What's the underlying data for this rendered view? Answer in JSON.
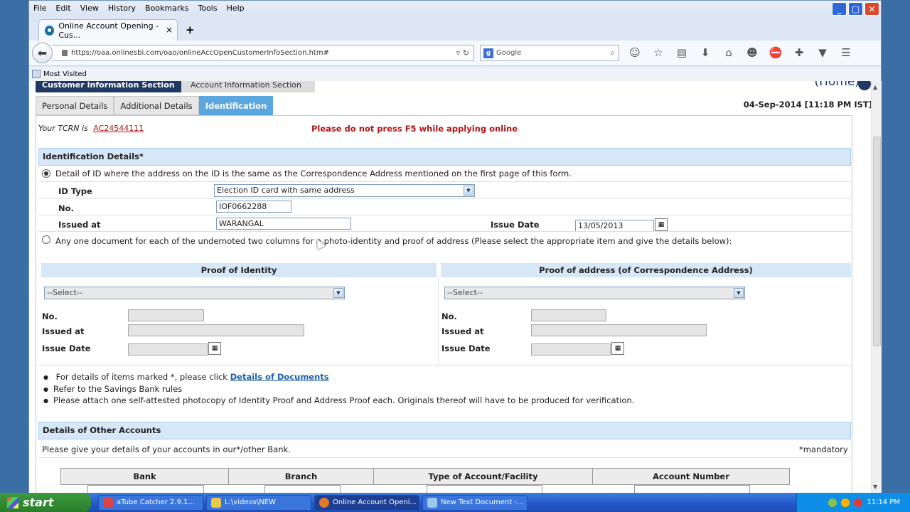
{
  "browser": {
    "menu": [
      "File",
      "Edit",
      "View",
      "History",
      "Bookmarks",
      "Tools",
      "Help"
    ],
    "tab_title": "Online Account Opening - Cus...",
    "tab_close": "×",
    "new_tab": "+",
    "url": "https://oaa.onlinesbi.com/oao/onlineAccOpenCustomerInfoSection.htm#",
    "search_engine_glyph": "g",
    "search_placeholder": "Google",
    "bookmark_most_visited": "Most Visited"
  },
  "page": {
    "section_tab_active": "Customer Information Section",
    "section_tab_inactive": "Account Information Section",
    "home_label": "(Home)",
    "subtabs": [
      "Personal Details",
      "Additional Details",
      "Identification"
    ],
    "datetime": "04-Sep-2014 [11:18 PM IST]",
    "tcrn_label": "Your TCRN is",
    "tcrn_value": "AC24544111",
    "warning": "Please do not press F5 while applying online",
    "id_details_header": "Identification Details*",
    "option1_text": "Detail of ID where the address on the ID is the same as the Correspondence Address mentioned on the first page of this form.",
    "id_type_label": "ID Type",
    "id_type_value": "Election ID card with same address",
    "no_label": "No.",
    "no_value": "IOF0662288",
    "issued_at_label": "Issued at",
    "issued_at_value": "WARANGAL",
    "issue_date_label": "Issue Date",
    "issue_date_value": "13/05/2013",
    "option2_text": "Any one document for each of the undernoted two columns for a photo-identity and proof of address (Please select the appropriate item  and give the details below):",
    "proof_identity_header": "Proof of Identity",
    "proof_address_header": "Proof of address (of Correspondence Address)",
    "select_placeholder": "--Select--",
    "left_no": "No.",
    "left_issued_at": "Issued at",
    "left_issue_date": "Issue Date",
    "right_no": "No.",
    "right_issued_at": "Issued at",
    "right_issue_date": "Issue Date",
    "note1_prefix": "For details of items marked *, please click ",
    "note1_link": "Details of Documents",
    "note2": "Refer to the Savings Bank rules",
    "note3": "Please attach one self-attested photocopy of Identity Proof and Address Proof each. Originals thereof will have to be produced for verification.",
    "other_accounts_header": "Details of Other Accounts",
    "other_accounts_text": "Please give your details of your accounts in our*/other Bank.",
    "mandatory_note": "*mandatory",
    "table_headers": [
      "Bank",
      "Branch",
      "Type of Account/Facility",
      "Account Number"
    ]
  },
  "taskbar": {
    "start": "start",
    "items": [
      "aTube Catcher 2.9.1...",
      "L:\\videos\\NEW",
      "Online Account Openi...",
      "New Text Document -..."
    ],
    "clock": "11:14 PM"
  }
}
